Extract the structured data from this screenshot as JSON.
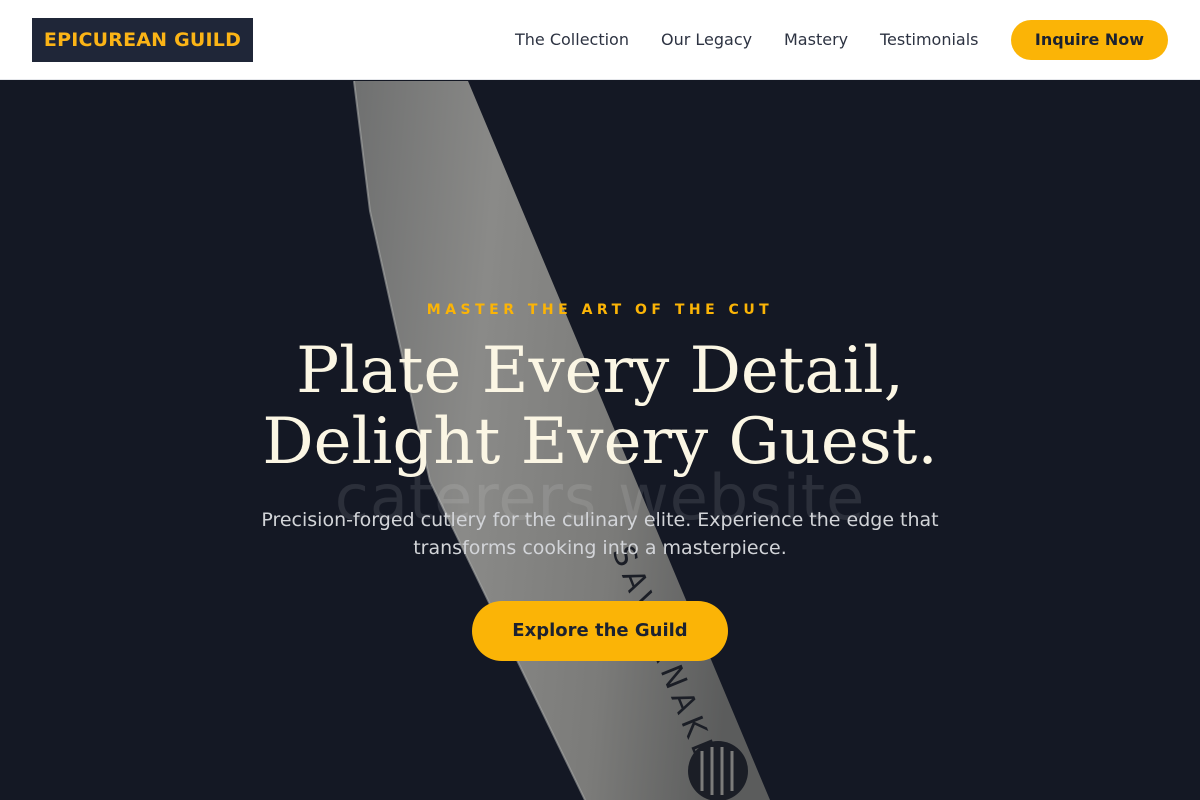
{
  "header": {
    "logo_text": "EPICUREAN GUILD",
    "nav": [
      {
        "label": "The Collection"
      },
      {
        "label": "Our Legacy"
      },
      {
        "label": "Mastery"
      },
      {
        "label": "Testimonials"
      }
    ],
    "cta_label": "Inquire Now"
  },
  "hero": {
    "eyebrow": "MASTER THE ART OF THE CUT",
    "headline_line1": "Plate Every Detail,",
    "headline_line2": "Delight Every Guest.",
    "subtext": "Precision-forged cutlery for the culinary elite. Experience the edge that transforms cooking into a masterpiece.",
    "cta_label": "Explore the Guild",
    "watermark": "caterers website",
    "blade_engraving": "SAVERNAKE"
  },
  "colors": {
    "accent": "#fbb406",
    "header_bg": "#ffffff",
    "logo_bg": "#1f2638",
    "hero_bg": "#141824",
    "headline": "#fbf6e4"
  }
}
